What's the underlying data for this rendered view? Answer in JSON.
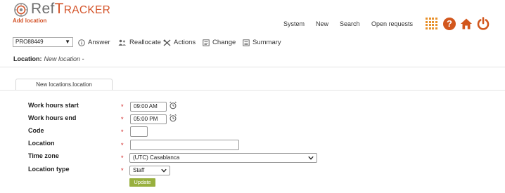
{
  "app": {
    "logo_ref": "Ref",
    "logo_t": "T",
    "logo_racker": "RACKER",
    "subtitle": "Add location"
  },
  "topnav": {
    "items": [
      "System",
      "New",
      "Search",
      "Open requests"
    ]
  },
  "toolbar": {
    "request_select_value": "PRO88449",
    "answer": "Answer",
    "reallocate": "Reallocate",
    "actions": "Actions",
    "change": "Change",
    "summary": "Summary"
  },
  "location": {
    "label": "Location:",
    "value": "New location -"
  },
  "tab": {
    "label": "New locations.location"
  },
  "form": {
    "work_hours_start": {
      "label": "Work hours start",
      "value": "09:00 AM"
    },
    "work_hours_end": {
      "label": "Work hours end",
      "value": "05:00 PM"
    },
    "code": {
      "label": "Code",
      "value": ""
    },
    "location": {
      "label": "Location",
      "value": ""
    },
    "time_zone": {
      "label": "Time zone",
      "value": "(UTC) Casablanca"
    },
    "location_type": {
      "label": "Location type",
      "value": "Staff"
    },
    "required_marker": "*",
    "update_label": "Update"
  },
  "colors": {
    "brand_orange": "#d4542a",
    "grid_orange": "#e8912b",
    "update_green": "#98b03e",
    "required_red": "#d02020"
  },
  "icons": [
    "reftracker-logo-icon",
    "apps-grid-icon",
    "help-icon",
    "home-icon",
    "power-icon",
    "info-icon",
    "reallocate-icon",
    "tools-icon",
    "change-icon",
    "summary-icon",
    "alarm-clock-icon",
    "chevron-down-icon"
  ]
}
